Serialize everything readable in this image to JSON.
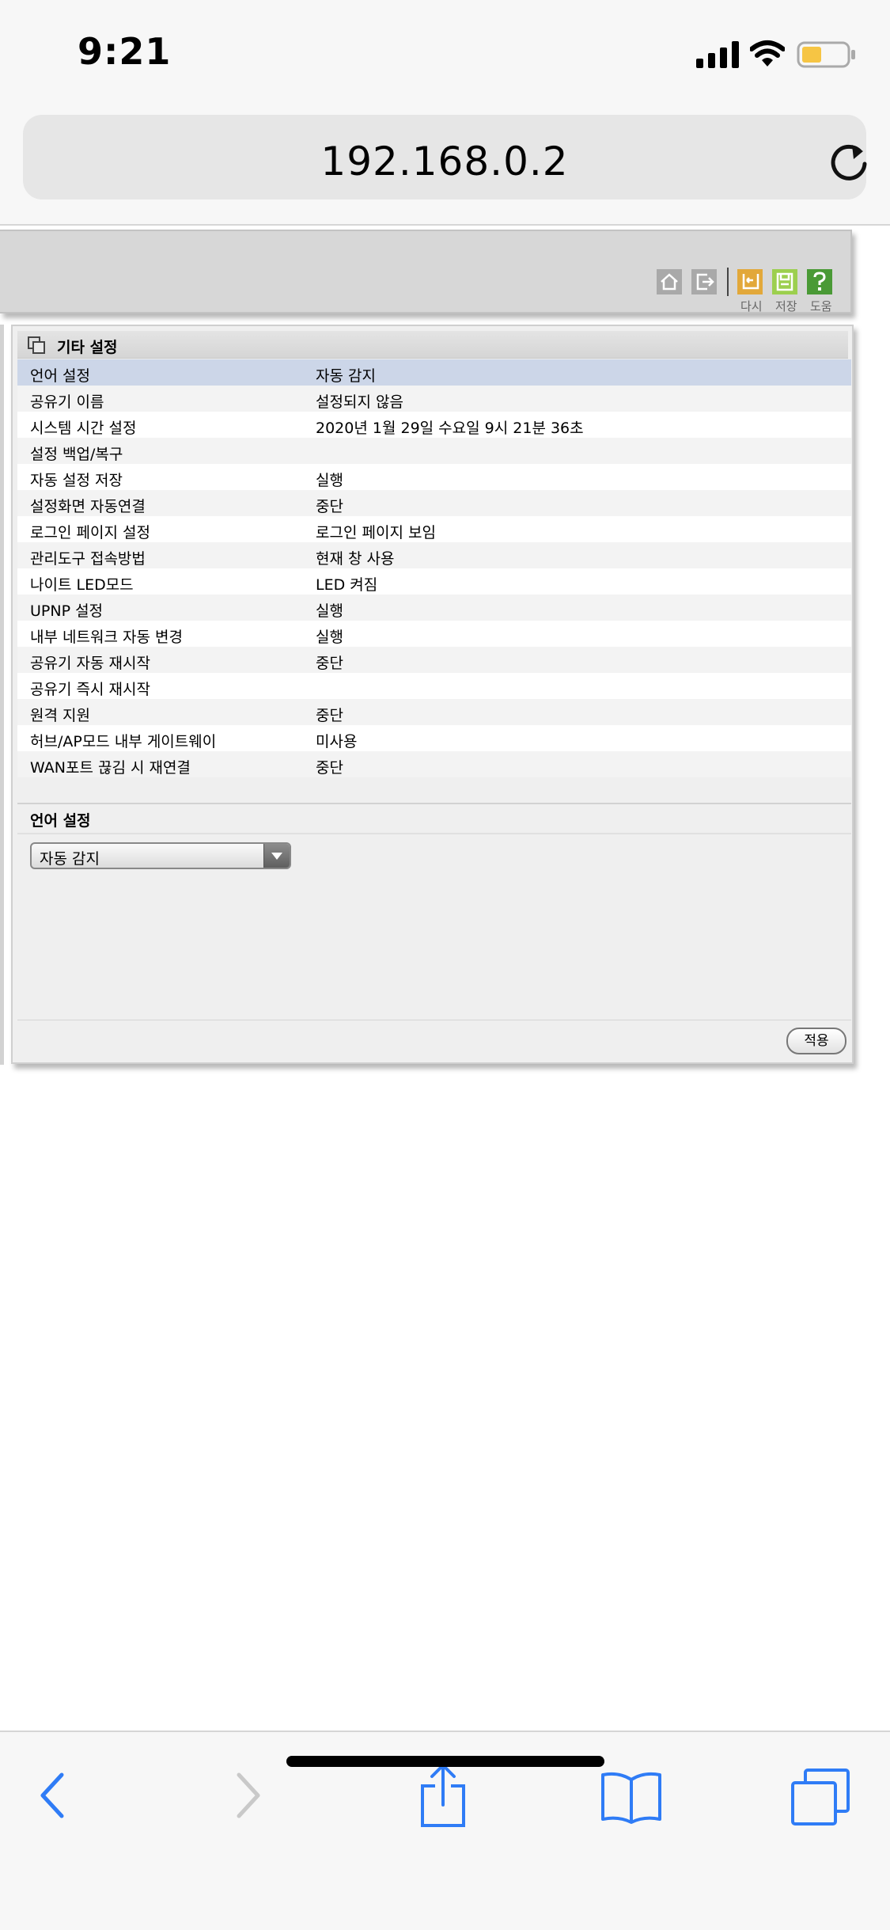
{
  "status_bar": {
    "time": "9:21"
  },
  "browser": {
    "url": "192.168.0.2"
  },
  "toolbar": {
    "labels": {
      "reset": "다시",
      "save": "저장",
      "help": "도움"
    }
  },
  "panel": {
    "title": "기타 설정",
    "rows": [
      {
        "key": "언어 설정",
        "value": "자동 감지"
      },
      {
        "key": "공유기 이름",
        "value": "설정되지 않음"
      },
      {
        "key": "시스템 시간 설정",
        "value": "2020년 1월 29일 수요일 9시 21분 36초"
      },
      {
        "key": "설정 백업/복구",
        "value": ""
      },
      {
        "key": "자동 설정 저장",
        "value": "실행"
      },
      {
        "key": "설정화면 자동연결",
        "value": "중단"
      },
      {
        "key": "로그인 페이지 설정",
        "value": "로그인 페이지 보임"
      },
      {
        "key": "관리도구 접속방법",
        "value": "현재 창 사용"
      },
      {
        "key": "나이트 LED모드",
        "value": "LED 켜짐"
      },
      {
        "key": "UPNP 설정",
        "value": "실행"
      },
      {
        "key": "내부 네트워크 자동 변경",
        "value": "실행"
      },
      {
        "key": "공유기 자동 재시작",
        "value": "중단"
      },
      {
        "key": "공유기 즉시 재시작",
        "value": ""
      },
      {
        "key": "원격 지원",
        "value": "중단"
      },
      {
        "key": "허브/AP모드 내부 게이트웨이",
        "value": "미사용"
      },
      {
        "key": "WAN포트 끊김 시 재연결",
        "value": "중단"
      }
    ],
    "section_title": "언어 설정",
    "language_select": {
      "value": "자동 감지"
    },
    "apply_label": "적용"
  },
  "colors": {
    "selected_row": "#ccd6e8",
    "ios_blue": "#2f7cf6"
  }
}
